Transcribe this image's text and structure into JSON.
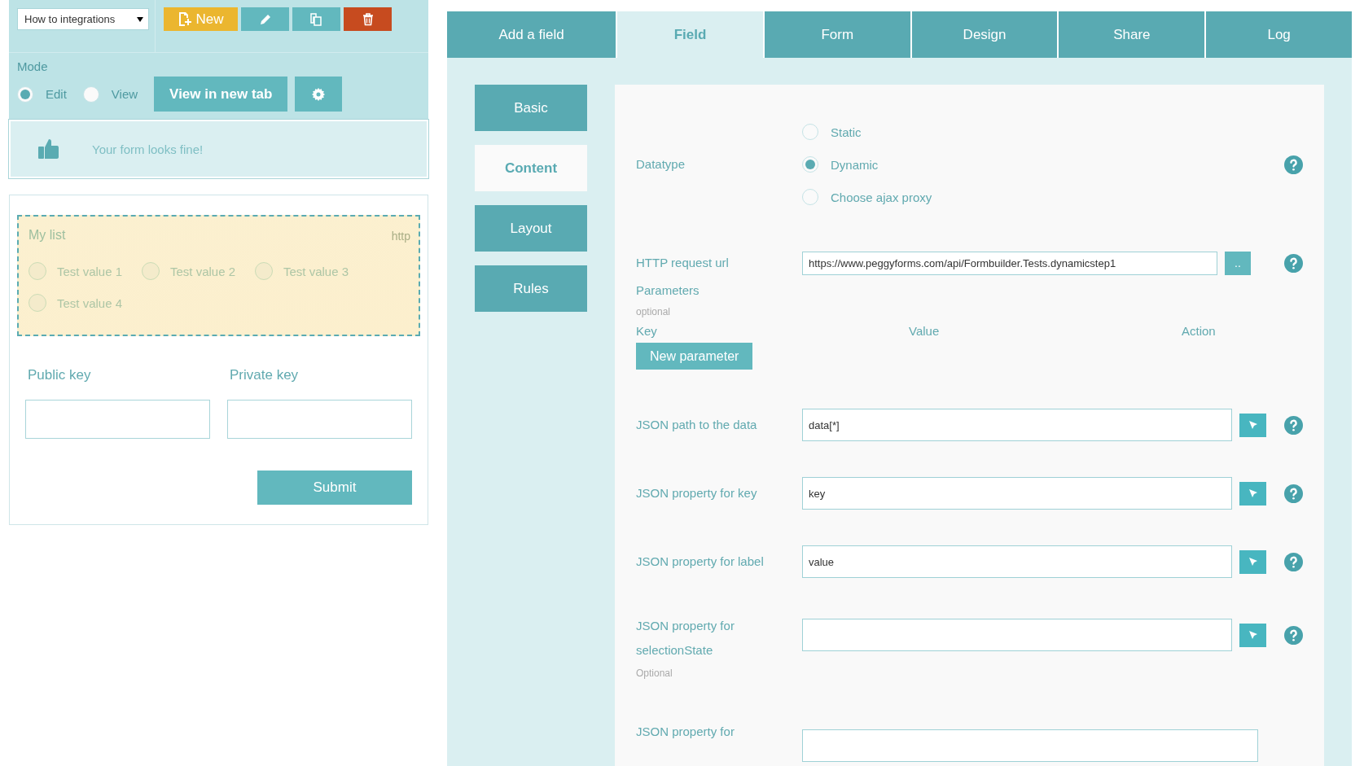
{
  "toolbar": {
    "form_select": "How to integrations",
    "actions": [
      {
        "kind": "new",
        "label": "New"
      },
      {
        "kind": "edit"
      },
      {
        "kind": "copy"
      },
      {
        "kind": "delete"
      }
    ]
  },
  "mode": {
    "title": "Mode",
    "options": [
      {
        "label": "Edit",
        "selected": true
      },
      {
        "label": "View",
        "selected": false
      }
    ],
    "view_button": "View in new tab"
  },
  "status": {
    "message": "Your form looks fine!"
  },
  "preview": {
    "list": {
      "title": "My list",
      "hint": "http",
      "options": [
        {
          "label": "Test value 1",
          "selected": false
        },
        {
          "label": "Test value 2",
          "selected": false
        },
        {
          "label": "Test value 3",
          "selected": false
        },
        {
          "label": "Test value 4",
          "selected": false
        }
      ]
    },
    "fields": [
      {
        "label": "Public key"
      },
      {
        "label": "Private key"
      }
    ],
    "submit": "Submit"
  },
  "tabs": [
    {
      "label": "Add a field",
      "selected": false
    },
    {
      "label": "Field",
      "selected": true
    },
    {
      "label": "Form",
      "selected": false
    },
    {
      "label": "Design",
      "selected": false
    },
    {
      "label": "Share",
      "selected": false
    },
    {
      "label": "Log",
      "selected": false
    }
  ],
  "subnav": [
    {
      "label": "Basic",
      "selected": false
    },
    {
      "label": "Content",
      "selected": true
    },
    {
      "label": "Layout",
      "selected": false
    },
    {
      "label": "Rules",
      "selected": false
    }
  ],
  "datatype": {
    "label": "Datatype",
    "options": [
      {
        "label": "Static",
        "selected": false
      },
      {
        "label": "Dynamic",
        "selected": true
      },
      {
        "label": "Choose ajax proxy",
        "selected": false
      }
    ]
  },
  "http": {
    "label": "HTTP request url",
    "value": "https://www.peggyforms.com/api/Formbuilder.Tests.dynamicstep1",
    "button": ".."
  },
  "parameters": {
    "label": "Parameters",
    "note": "optional",
    "columns": [
      "Key",
      "Value",
      "Action"
    ],
    "button": "New parameter"
  },
  "json_rows": [
    {
      "kind": "select",
      "label": "JSON path to the data",
      "value": "data[*]"
    },
    {
      "kind": "select",
      "label": "JSON property for key",
      "value": "key"
    },
    {
      "kind": "select",
      "label": "JSON property for label",
      "value": "value"
    },
    {
      "kind": "select",
      "label": "JSON property for selectionState",
      "note": "Optional"
    },
    {
      "kind": "partial",
      "label": "JSON property for"
    }
  ]
}
